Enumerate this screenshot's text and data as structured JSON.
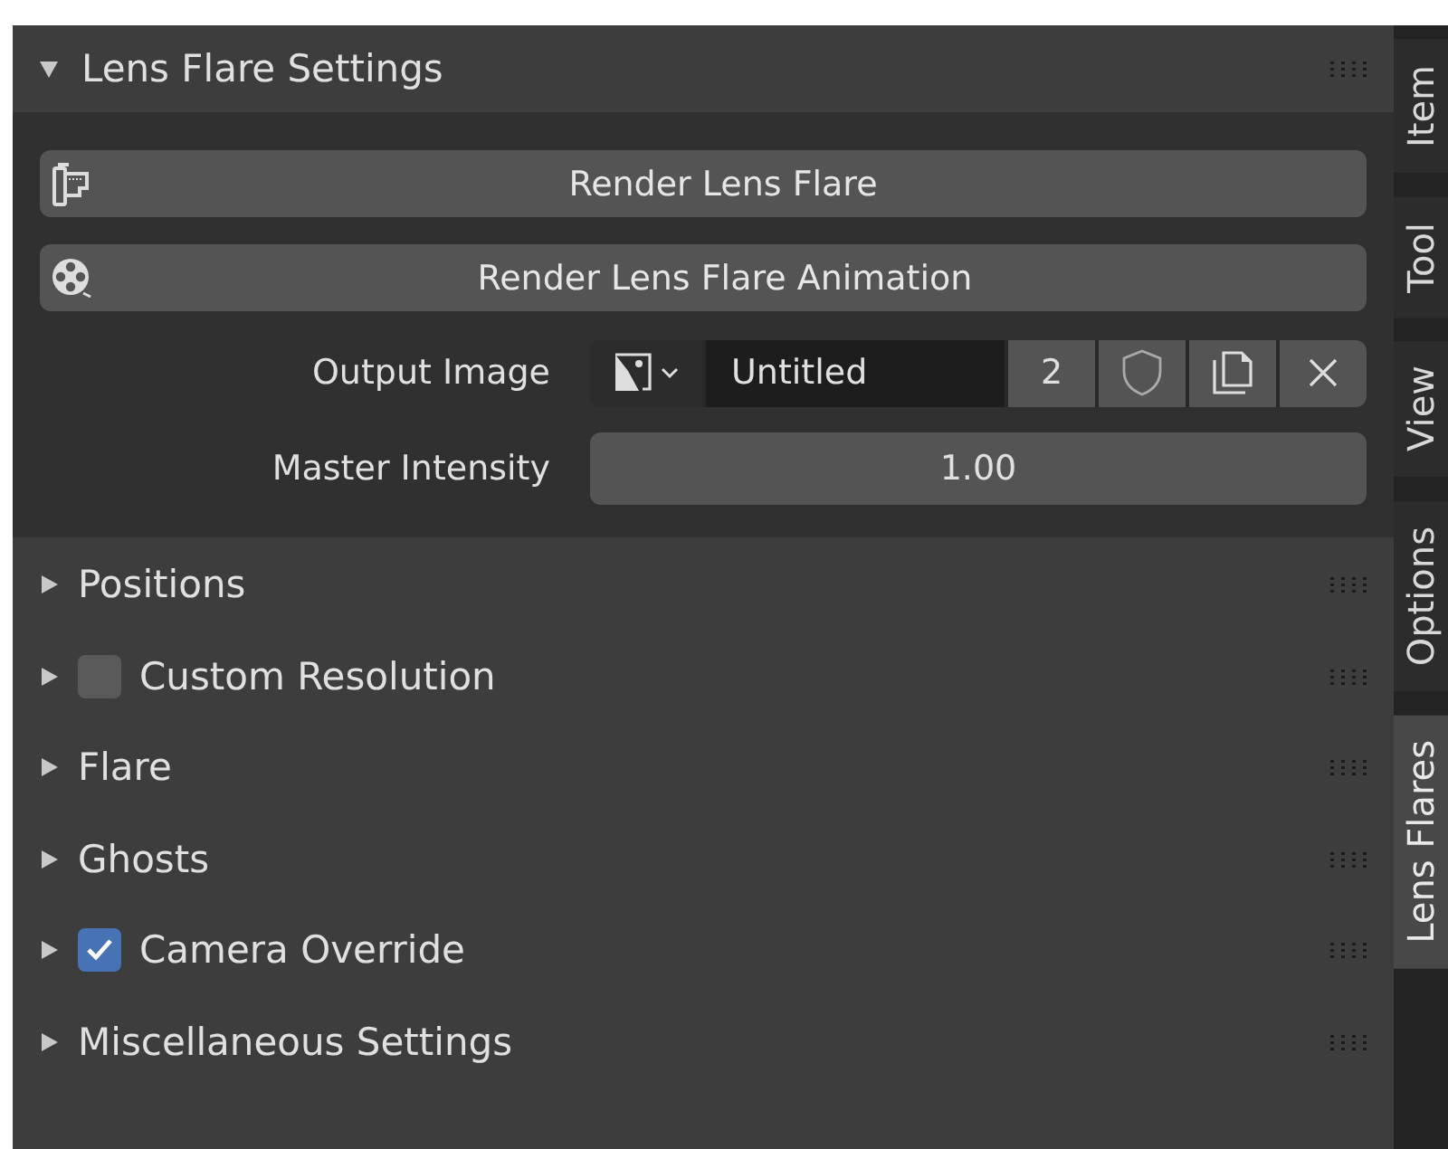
{
  "panel": {
    "title": "Lens Flare Settings",
    "expanded": true
  },
  "buttons": [
    {
      "kind": "film",
      "label": "Render Lens Flare"
    },
    {
      "kind": "reel",
      "label": "Render Lens Flare Animation"
    }
  ],
  "output_image": {
    "label": "Output Image",
    "name": "Untitled",
    "users": "2"
  },
  "master_intensity": {
    "label": "Master Intensity",
    "value": "1.00"
  },
  "subpanels": [
    {
      "label": "Positions",
      "expanded": false,
      "kind": "plain"
    },
    {
      "label": "Custom Resolution",
      "expanded": false,
      "kind": "checkbox",
      "checked": false
    },
    {
      "label": "Flare",
      "expanded": false,
      "kind": "plain"
    },
    {
      "label": "Ghosts",
      "expanded": false,
      "kind": "plain"
    },
    {
      "label": "Camera Override",
      "expanded": false,
      "kind": "checkbox",
      "checked": true
    },
    {
      "label": "Miscellaneous Settings",
      "expanded": false,
      "kind": "plain"
    }
  ],
  "tabs": [
    {
      "label": "Item",
      "selected": false
    },
    {
      "label": "Tool",
      "selected": false
    },
    {
      "label": "View",
      "selected": false
    },
    {
      "label": "Options",
      "selected": false
    },
    {
      "label": "Lens Flares",
      "selected": true
    }
  ]
}
